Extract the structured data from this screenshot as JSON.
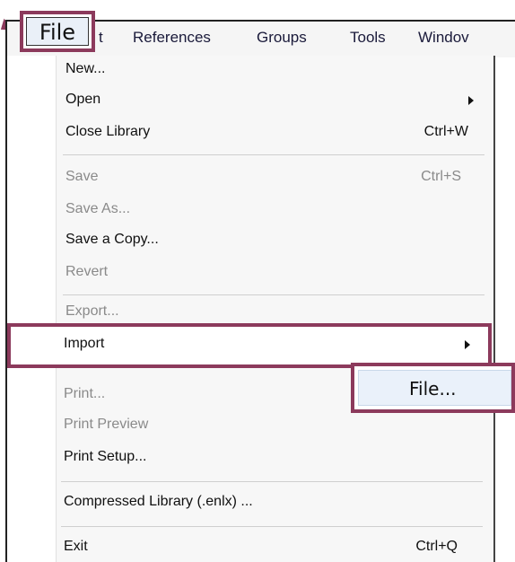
{
  "menubar": {
    "items": [
      "File",
      "Edit",
      "References",
      "Groups",
      "Tools",
      "Window"
    ],
    "visible_labels": {
      "edit_fragment": "t",
      "references": "References",
      "groups": "Groups",
      "tools": "Tools",
      "window_fragment": "Windov"
    }
  },
  "file_button": {
    "label": "File"
  },
  "menu": {
    "new": {
      "label": "New..."
    },
    "open": {
      "label": "Open"
    },
    "close_library": {
      "label": "Close Library",
      "shortcut": "Ctrl+W"
    },
    "save": {
      "label": "Save",
      "shortcut": "Ctrl+S"
    },
    "save_as": {
      "label": "Save As..."
    },
    "save_copy": {
      "label": "Save a Copy..."
    },
    "revert": {
      "label": "Revert"
    },
    "export": {
      "label": "Export..."
    },
    "import": {
      "label": "Import"
    },
    "print": {
      "label": "Print..."
    },
    "print_preview": {
      "label": "Print Preview"
    },
    "print_setup": {
      "label": "Print Setup..."
    },
    "compressed": {
      "label": "Compressed Library (.enlx) ..."
    },
    "exit": {
      "label": "Exit",
      "shortcut": "Ctrl+Q"
    }
  },
  "submenu": {
    "file": {
      "label": "File..."
    }
  },
  "colors": {
    "highlight_border": "#8c3a5c",
    "disabled_text": "#8a8a8a",
    "submenu_hover": "#eaf1fa"
  }
}
